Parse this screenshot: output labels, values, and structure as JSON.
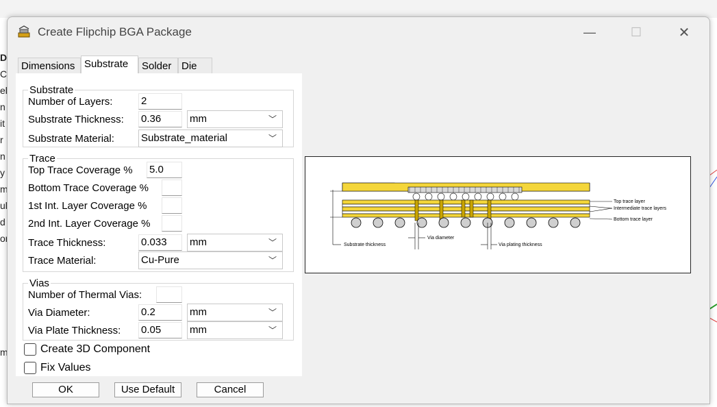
{
  "dialog": {
    "title": "Create Flipchip BGA Package",
    "icon": "flipchip-app-icon",
    "controls": {
      "minimize": "—",
      "maximize": "☐",
      "close": "✕"
    }
  },
  "tabs": [
    {
      "label": "Dimensions",
      "active": false
    },
    {
      "label": "Substrate",
      "active": true
    },
    {
      "label": "Solder",
      "active": false
    },
    {
      "label": "Die",
      "active": false
    }
  ],
  "substrate": {
    "group_label": "Substrate",
    "layers_label": "Number of Layers:",
    "layers_value": "2",
    "thickness_label": "Substrate Thickness:",
    "thickness_value": "0.36",
    "thickness_unit": "mm",
    "material_label": "Substrate Material:",
    "material_value": "Substrate_material"
  },
  "trace": {
    "group_label": "Trace",
    "top_label": "Top Trace Coverage %",
    "top_value": "5.0",
    "bottom_label": "Bottom Trace Coverage %",
    "bottom_value": "",
    "int1_label": "1st Int. Layer Coverage %",
    "int1_value": "",
    "int2_label": "2nd Int. Layer Coverage %",
    "int2_value": "",
    "thickness_label": "Trace Thickness:",
    "thickness_value": "0.033",
    "thickness_unit": "mm",
    "material_label": "Trace Material:",
    "material_value": "Cu-Pure"
  },
  "vias": {
    "group_label": "Vias",
    "thermal_label": "Number of Thermal Vias:",
    "thermal_value": "",
    "diameter_label": "Via Diameter:",
    "diameter_value": "0.2",
    "diameter_unit": "mm",
    "plate_label": "Via Plate Thickness:",
    "plate_value": "0.05",
    "plate_unit": "mm"
  },
  "options": {
    "create3d_label": "Create 3D Component",
    "create3d_checked": false,
    "fix_label": "Fix Values",
    "fix_checked": false
  },
  "buttons": {
    "ok": "OK",
    "use_default": "Use Default",
    "cancel": "Cancel"
  },
  "diagram_labels": {
    "top_trace": "Top trace layer",
    "intermediate": "Intermediate trace layers",
    "bottom_trace": "Bottom trace layer",
    "substrate_thickness": "Substrate thickness",
    "via_diameter": "Via diameter",
    "via_plating": "Via plating thickness"
  },
  "colors": {
    "substrate": "#f4d63a",
    "trace": "#c9a400",
    "ball": "#cfcfcf",
    "die": "#e8e8e8"
  },
  "background_edge_chars": [
    "D",
    "C",
    "el",
    "n",
    "it",
    "r",
    "n",
    "y",
    "m",
    "ul",
    "d",
    "on",
    "mi"
  ]
}
